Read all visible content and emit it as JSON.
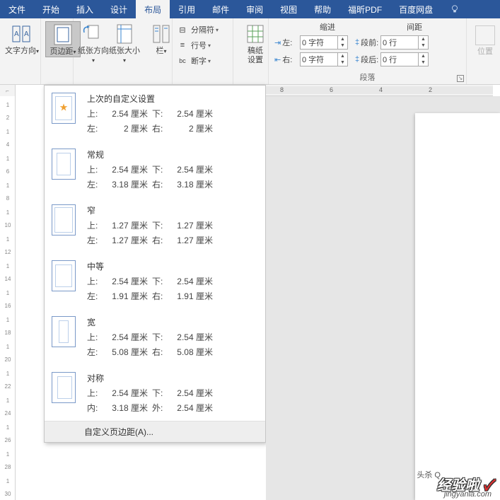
{
  "tabs": [
    "文件",
    "开始",
    "插入",
    "设计",
    "布局",
    "引用",
    "邮件",
    "审阅",
    "视图",
    "帮助",
    "福昕PDF",
    "百度网盘"
  ],
  "active_tab_index": 4,
  "ribbon": {
    "text_direction": "文字方向",
    "margins": "页边距",
    "orientation": "纸张方向",
    "size": "纸张大小",
    "columns": "栏",
    "breaks": "分隔符",
    "line_numbers": "行号",
    "hyphenation": "断字",
    "manuscript": "稿纸\n设置",
    "indent_label": "缩进",
    "spacing_label": "间距",
    "indent_left": "左:",
    "indent_right": "右:",
    "indent_left_val": "0 字符",
    "indent_right_val": "0 字符",
    "space_before": "段前:",
    "space_after": "段后:",
    "space_before_val": "0 行",
    "space_after_val": "0 行",
    "paragraph": "段落",
    "position": "位置"
  },
  "dropdown": {
    "presets": [
      {
        "title": "上次的自定义设置",
        "thumb": "last",
        "star": true,
        "k1": "上:",
        "v1": "2.54 厘米",
        "k2": "下:",
        "v2": "2.54 厘米",
        "k3": "左:",
        "v3": "2 厘米",
        "k4": "右:",
        "v4": "2 厘米"
      },
      {
        "title": "常规",
        "thumb": "normal",
        "k1": "上:",
        "v1": "2.54 厘米",
        "k2": "下:",
        "v2": "2.54 厘米",
        "k3": "左:",
        "v3": "3.18 厘米",
        "k4": "右:",
        "v4": "3.18 厘米"
      },
      {
        "title": "窄",
        "thumb": "narrow",
        "k1": "上:",
        "v1": "1.27 厘米",
        "k2": "下:",
        "v2": "1.27 厘米",
        "k3": "左:",
        "v3": "1.27 厘米",
        "k4": "右:",
        "v4": "1.27 厘米"
      },
      {
        "title": "中等",
        "thumb": "medium",
        "k1": "上:",
        "v1": "2.54 厘米",
        "k2": "下:",
        "v2": "2.54 厘米",
        "k3": "左:",
        "v3": "1.91 厘米",
        "k4": "右:",
        "v4": "1.91 厘米"
      },
      {
        "title": "宽",
        "thumb": "wide",
        "k1": "上:",
        "v1": "2.54 厘米",
        "k2": "下:",
        "v2": "2.54 厘米",
        "k3": "左:",
        "v3": "5.08 厘米",
        "k4": "右:",
        "v4": "5.08 厘米"
      },
      {
        "title": "对称",
        "thumb": "mirror",
        "k1": "上:",
        "v1": "2.54 厘米",
        "k2": "下:",
        "v2": "2.54 厘米",
        "k3": "内:",
        "v3": "3.18 厘米",
        "k4": "外:",
        "v4": "2.54 厘米"
      }
    ],
    "custom": "自定义页边距(A)..."
  },
  "vruler_ticks": [
    "2",
    "",
    "4",
    "1",
    "6",
    "",
    "8",
    "1",
    "10",
    "1",
    "12",
    "1",
    "14",
    "1",
    "16",
    "1",
    "18",
    "1",
    "20",
    "1",
    "22",
    "1",
    "24",
    "1",
    "26",
    "1",
    "28",
    "1",
    "30",
    "1"
  ],
  "hruler_ticks": [
    "8",
    "6",
    "4",
    "2"
  ],
  "watermark": {
    "text": "经验啦",
    "check": "✓",
    "url": "jingyanla.com",
    "head": "头杀 Q"
  }
}
